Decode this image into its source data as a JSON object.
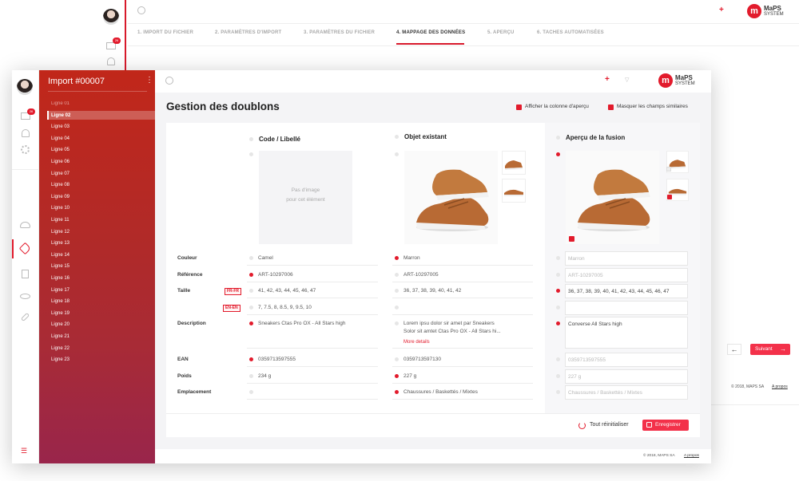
{
  "bg": {
    "steps": [
      "1. IMPORT DU FICHIER",
      "2. PARAMÈTRES D'IMPORT",
      "3. PARAMÈTRES DU FICHIER",
      "4. MAPPAGE DES DONNÉES",
      "5. APERÇU",
      "6. TACHES AUTOMATISÉES"
    ],
    "badge": "26",
    "logo_top": "MaPS",
    "logo_bottom": "SYSTEM",
    "next": "Suivant",
    "copyright": "© 2018, MAPS SA",
    "about": "A propos"
  },
  "sidebar": {
    "badge": "26"
  },
  "import": {
    "title": "Import #00007",
    "items": [
      "Ligne 01",
      "Ligne 02",
      "Ligne 03",
      "Ligne 04",
      "Ligne 05",
      "Ligne 06",
      "Ligne 07",
      "Ligne 08",
      "Ligne 09",
      "Ligne 10",
      "Ligne 11",
      "Ligne 12",
      "Ligne 13",
      "Ligne 14",
      "Ligne 15",
      "Ligne 16",
      "Ligne 17",
      "Ligne 18",
      "Ligne 19",
      "Ligne 20",
      "Ligne 21",
      "Ligne 22",
      "Ligne 23"
    ],
    "selected_index": 1
  },
  "logo": {
    "top": "MaPS",
    "bottom": "SYSTEM"
  },
  "page": {
    "title": "Gestion des doublons",
    "opt_preview": "Afficher la colonne d'aperçu",
    "opt_hide": "Masquer les champs similaires"
  },
  "columns": {
    "c1": "Code / Libellé",
    "c2": "Objet existant",
    "c3": "Aperçu de la fusion"
  },
  "noimage": {
    "line1": "Pas d'image",
    "line2": "pour cet élément"
  },
  "labels": {
    "couleur": "Couleur",
    "reference": "Référence",
    "taille": "Taille",
    "description": "Description",
    "ean": "EAN",
    "poids": "Poids",
    "emplacement": "Emplacement",
    "fr": "FR-FR",
    "en": "EN-EN"
  },
  "c1": {
    "couleur": "Camel",
    "reference": "ART-10297006",
    "taille_fr": "41, 42, 43, 44, 45, 46, 47",
    "taille_en": "7, 7.5, 8, 8.5, 9, 9.5, 10",
    "description": "Sneakers Ctas Pro OX - All Stars high",
    "ean": "0359713597555",
    "poids": "234 g",
    "emplacement": ""
  },
  "c2": {
    "couleur": "Marron",
    "reference": "ART-10297005",
    "taille_fr": "36, 37, 38, 39, 40, 41, 42",
    "taille_en": "",
    "description_l1": "Lorem ipsu dolor sir amet par Sneakers",
    "description_l2": "Solor sit amtet Ctas Pro OX - All Stars hi...",
    "more": "More details",
    "ean": "0359713597130",
    "poids": "227 g",
    "emplacement": "Chaussures / Baskettés / Mixtes"
  },
  "c3": {
    "couleur": "Marron",
    "reference": "ART-10297005",
    "taille_fr": "36, 37, 38, 39, 40, 41, 42, 43, 44, 45, 46, 47",
    "taille_en": "",
    "description": "Converse All Stars high",
    "ean": "0359713597555",
    "poids": "227 g",
    "emplacement": "Chaussures / Baskettés / Mixtes"
  },
  "actions": {
    "reset": "Tout réinitialiser",
    "save": "Enregistrer"
  },
  "footer": {
    "copyright": "© 2018, MAPS SA",
    "about": "A propos"
  },
  "colors": {
    "accent": "#e21b2c",
    "gradient_top": "#c1271a",
    "gradient_bottom": "#99254b"
  },
  "icons": [
    "search-icon",
    "plus-icon",
    "filter-icon",
    "mail-icon",
    "bell-icon",
    "gear-icon",
    "cloud-icon",
    "tag-icon",
    "document-icon",
    "eye-icon",
    "link-icon",
    "list-icon",
    "more-icon",
    "reset-icon",
    "save-icon",
    "arrow-left-icon",
    "arrow-right-icon"
  ]
}
